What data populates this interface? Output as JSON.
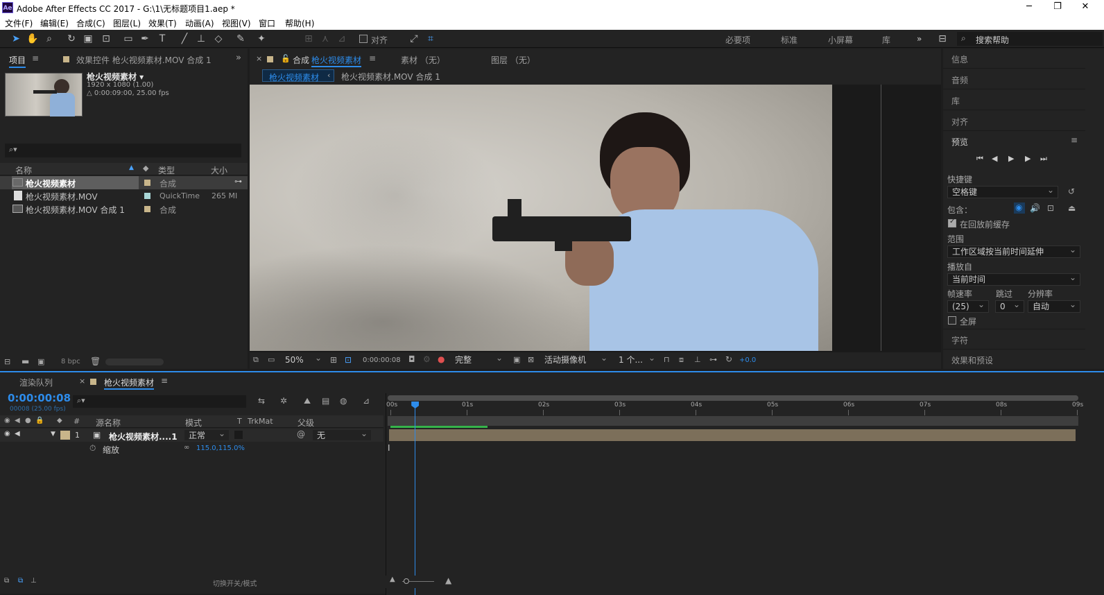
{
  "window": {
    "title": "Adobe After Effects CC 2017 - G:\\1\\无标题项目1.aep *",
    "app_icon": "Ae",
    "minimize": "─",
    "restore": "❐",
    "close": "✕"
  },
  "menu": [
    "文件(F)",
    "编辑(E)",
    "合成(C)",
    "图层(L)",
    "效果(T)",
    "动画(A)",
    "视图(V)",
    "窗口",
    "帮助(H)"
  ],
  "toolbar": {
    "snap_label": "对齐",
    "workspaces": [
      "必要项",
      "标准",
      "小屏幕",
      "库"
    ],
    "more": "»",
    "search_placeholder": "搜索帮助"
  },
  "project_panel": {
    "tab_label": "项目",
    "effects_tab": "效果控件 枪火视频素材.MOV 合成 1",
    "more": "»",
    "selected_name": "枪火视频素材 ▾",
    "selected_info1": "1920 x 1080 (1.00)",
    "selected_info2": "△ 0:00:09:00, 25.00 fps",
    "search_icon": "⌕▾",
    "columns": {
      "name": "名称",
      "type": "类型",
      "size": "大小"
    },
    "items": [
      {
        "name": "枪火视频素材",
        "type": "合成",
        "size": ""
      },
      {
        "name": "枪火视频素材.MOV",
        "type": "QuickTime",
        "size": "265 MI"
      },
      {
        "name": "枪火视频素材.MOV 合成 1",
        "type": "合成",
        "size": ""
      }
    ],
    "bpc": "8 bpc"
  },
  "comp_panel": {
    "tab_prefix": "合成",
    "tab_name": "枪火视频素材",
    "footage_tab": "素材 （无）",
    "layer_tab": "图层 （无）",
    "breadcrumbs": [
      "枪火视频素材",
      "枪火视频素材.MOV 合成 1"
    ],
    "zoom": "50%",
    "timecode": "0:00:00:08",
    "resolution": "完整",
    "camera": "活动摄像机",
    "views": "1 个...",
    "exposure": "+0.0"
  },
  "right_panel": {
    "items_top": [
      "信息",
      "音频",
      "库",
      "对齐"
    ],
    "preview_title": "预览",
    "shortcut_label": "快捷键",
    "shortcut_value": "空格键",
    "include_label": "包含：",
    "cache_label": "在回放前缓存",
    "range_label": "范围",
    "range_value": "工作区域按当前时间延伸",
    "playfrom_label": "播放自",
    "playfrom_value": "当前时间",
    "fps_label": "帧速率",
    "skip_label": "跳过",
    "res_label": "分辨率",
    "fps_value": "(25)",
    "skip_value": "0",
    "res_value": "自动",
    "fullscreen_label": "全屏",
    "items_bottom": [
      "字符",
      "效果和预设"
    ]
  },
  "timeline": {
    "render_tab": "渲染队列",
    "comp_tab": "枪火视频素材",
    "timecode": "0:00:00:08",
    "fps_info": "00008 (25.00 fps)",
    "cols": {
      "num": "#",
      "source": "源名称",
      "mode": "模式",
      "t": "T",
      "trkmat": "TrkMat",
      "parent": "父级"
    },
    "layer": {
      "num": "1",
      "name": "枪火视频素材....1",
      "mode": "正常",
      "parent": "无"
    },
    "prop": {
      "name": "缩放",
      "value": "115.0,115.0%"
    },
    "ticks": [
      "00s",
      "01s",
      "02s",
      "03s",
      "04s",
      "05s",
      "06s",
      "07s",
      "08s",
      "09s"
    ],
    "footer": "切换开关/模式",
    "playhead_time_s": 0.32,
    "duration_s": 9
  },
  "colors": {
    "accent": "#2d8ceb",
    "label_sand": "#c8b58a",
    "track": "#7c6f5a",
    "work_green": "#35b34a"
  }
}
